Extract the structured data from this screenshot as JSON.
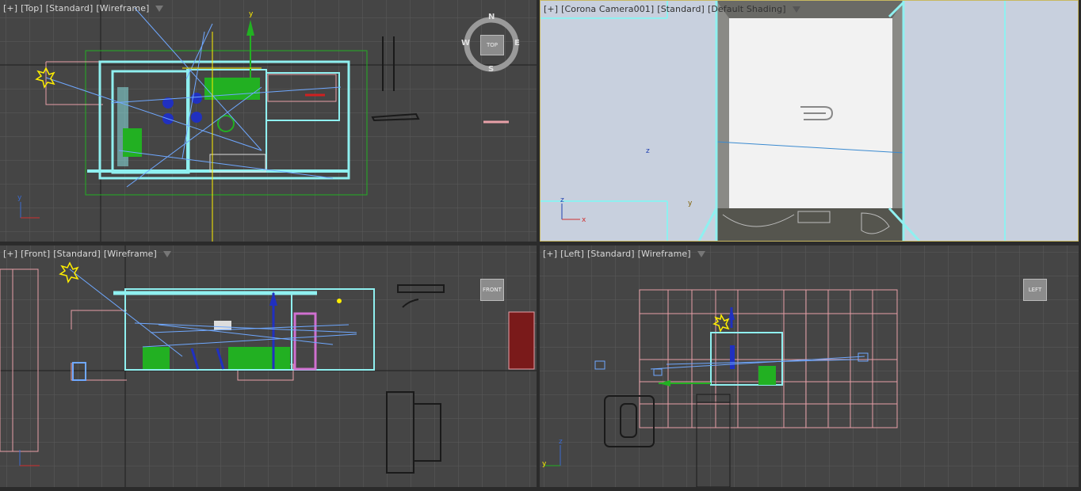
{
  "viewports": {
    "top": {
      "menu": "[+]",
      "view": "[Top]",
      "shading": "[Standard]",
      "mode": "[Wireframe]",
      "cube": "TOP",
      "compass": {
        "n": "N",
        "s": "S",
        "e": "E",
        "w": "W"
      },
      "axis_y": "y"
    },
    "camera": {
      "menu": "[+]",
      "view": "[Corona Camera001]",
      "shading": "[Standard]",
      "mode": "[Default Shading]",
      "axis_z": "z",
      "axis_x": "x",
      "axis_y": "y",
      "axis_z2": "z"
    },
    "front": {
      "menu": "[+]",
      "view": "[Front]",
      "shading": "[Standard]",
      "mode": "[Wireframe]",
      "cube": "FRONT"
    },
    "left": {
      "menu": "[+]",
      "view": "[Left]",
      "shading": "[Standard]",
      "mode": "[Wireframe]",
      "cube": "LEFT",
      "axis_y": "y",
      "axis_z": "z"
    }
  },
  "colors": {
    "background": "#454545",
    "grid": "#5a5a5a",
    "grid_major": "#222222",
    "wall_cyan": "#8ff0f0",
    "furniture_green": "#22b022",
    "light_blue": "#6fa8ff",
    "selection_pink": "#e8a0a8",
    "light_yellow": "#ffee00",
    "camera_sky": "#c8d0de"
  }
}
